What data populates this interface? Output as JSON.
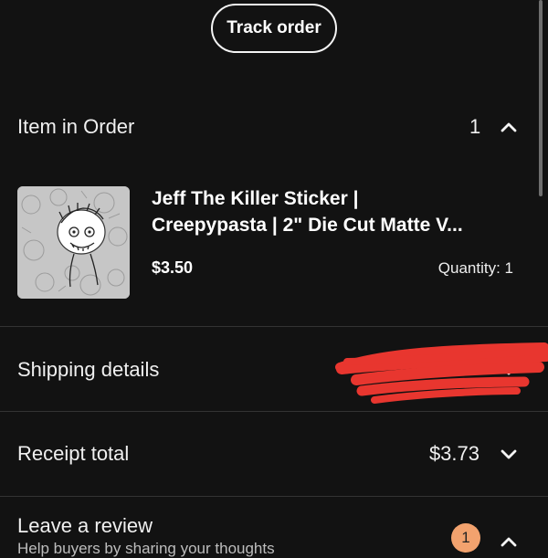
{
  "header": {
    "track_button": "Track order"
  },
  "item_section": {
    "title": "Item in Order",
    "count": "1",
    "chevron_icon": "chevron-up-icon",
    "item": {
      "title_line1": "Jeff The Killer Sticker |",
      "title_line2": "Creepypasta | 2\" Die Cut Matte V...",
      "price": "$3.50",
      "quantity": "Quantity: 1",
      "thumbnail_icon": "sticker-thumbnail"
    }
  },
  "shipping_section": {
    "title": "Shipping details",
    "chevron_icon": "chevron-down-icon"
  },
  "receipt_section": {
    "title": "Receipt total",
    "total": "$3.73",
    "chevron_icon": "chevron-down-icon"
  },
  "review_section": {
    "title": "Leave a review",
    "subtitle": "Help buyers by sharing your thoughts",
    "badge": "1",
    "chevron_icon": "chevron-up-icon"
  },
  "colors": {
    "background": "#121212",
    "text": "#f2f2f2",
    "divider": "#333333",
    "badge": "#f2a26e",
    "redaction": "#e8362f"
  }
}
